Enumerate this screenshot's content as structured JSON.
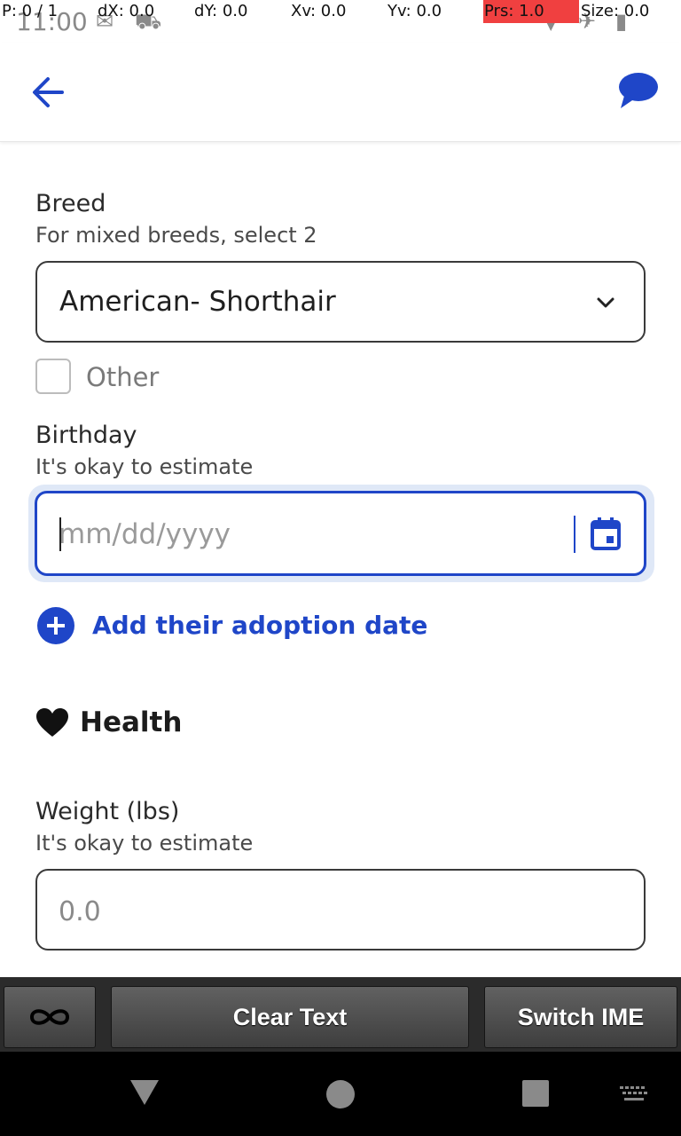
{
  "status_bar": {
    "time": "11:00",
    "pointer_overlay": {
      "p": "P: 0 / 1",
      "dx": "dX: 0.0",
      "dy": "dY: 0.0",
      "xv": "Xv: 0.0",
      "yv": "Yv: 0.0",
      "prs": "Prs: 1.0",
      "size": "Size: 0.0"
    }
  },
  "app_bar": {
    "back_icon": "arrow-left",
    "chat_icon": "speech-bubble"
  },
  "form": {
    "breed": {
      "label": "Breed",
      "hint": "For mixed breeds, select 2",
      "selected": "American- Shorthair"
    },
    "other": {
      "label": "Other",
      "checked": false
    },
    "birthday": {
      "label": "Birthday",
      "hint": "It's okay to estimate",
      "placeholder": "mm/dd/yyyy",
      "value": ""
    },
    "add_adoption_label": "Add their adoption date",
    "health_title": "Health",
    "weight": {
      "label": "Weight (lbs)",
      "hint": "It's okay to estimate",
      "placeholder": "0.0"
    }
  },
  "toolbar": {
    "clear_label": "Clear Text",
    "ime_label": "Switch IME",
    "infinity_icon": "infinity"
  },
  "colors": {
    "accent": "#1f46c8",
    "toolbar_bg": "#2b2b2b",
    "nav_bg": "#000000"
  }
}
